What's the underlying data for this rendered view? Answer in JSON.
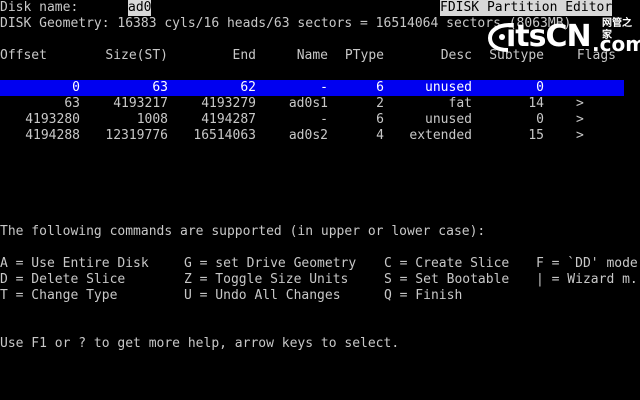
{
  "header": {
    "disk_name_label": "Disk name:",
    "disk_name_value": "ad0",
    "title": "FDISK Partition Editor",
    "geometry": "DISK Geometry: 16383 cyls/16 heads/63 sectors = 16514064 sectors (8063MB)"
  },
  "columns": {
    "offset": "Offset",
    "size": "Size(ST)",
    "end": "End",
    "name": "Name",
    "ptype": "PType",
    "desc": "Desc",
    "subtype": "Subtype",
    "flags": "Flags"
  },
  "partitions": [
    {
      "offset": "0",
      "size": "63",
      "end": "62",
      "name": "-",
      "ptype": "6",
      "desc": "unused",
      "subtype": "0",
      "flags": ""
    },
    {
      "offset": "63",
      "size": "4193217",
      "end": "4193279",
      "name": "ad0s1",
      "ptype": "2",
      "desc": "fat",
      "subtype": "14",
      "flags": ">"
    },
    {
      "offset": "4193280",
      "size": "1008",
      "end": "4194287",
      "name": "-",
      "ptype": "6",
      "desc": "unused",
      "subtype": "0",
      "flags": ">"
    },
    {
      "offset": "4194288",
      "size": "12319776",
      "end": "16514063",
      "name": "ad0s2",
      "ptype": "4",
      "desc": "extended",
      "subtype": "15",
      "flags": ">"
    }
  ],
  "commands": {
    "intro": "The following commands are supported (in upper or lower case):",
    "rows": [
      [
        "A = Use Entire Disk",
        "G = set Drive Geometry",
        "C = Create Slice",
        "F = `DD' mode"
      ],
      [
        "D = Delete Slice",
        "Z = Toggle Size Units",
        "S = Set Bootable",
        "| = Wizard m."
      ],
      [
        "T = Change Type",
        "U = Undo All Changes",
        "Q = Finish",
        ""
      ]
    ]
  },
  "help_text": "Use F1 or ? to get more help, arrow keys to select.",
  "watermark": {
    "main": "itsCN",
    "com": ".com",
    "sub": "网管之家"
  },
  "colors": {
    "background": "#000000",
    "text": "#c8c8c8",
    "selection": "#0000f0",
    "inverse_bg": "#d8d8d8"
  }
}
